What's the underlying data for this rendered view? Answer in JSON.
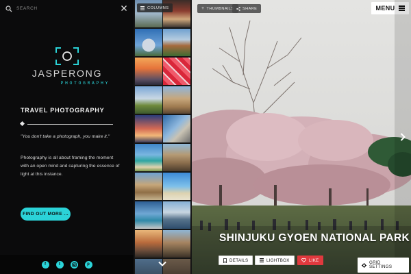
{
  "sidebar": {
    "search": {
      "placeholder": "SEARCH"
    },
    "logo": {
      "name": "JASPERONG",
      "sub": "PHOTOGRAPHY"
    },
    "section_title": "TRAVEL PHOTOGRAPHY",
    "quote": "\"You don't take a photograph, you make it.\"",
    "paragraph": "Photography is all about framing the moment with an open mind and capturing the essence of light at this instance.",
    "find_out_more": "FIND OUT MORE ...",
    "social": [
      "facebook-icon",
      "twitter-icon",
      "instagram-icon",
      "pinterest-icon"
    ]
  },
  "thumbstrip": {
    "columns_label": "COLUMNS"
  },
  "toolbar": {
    "thumbnails_label": "THUMBNAILS",
    "share_label": "SHARE",
    "menu_label": "MENU"
  },
  "photo": {
    "title": "SHINJUKU GYOEN NATIONAL PARK",
    "details_label": "DETAILS",
    "lightbox_label": "LIGHTBOX",
    "like_label": "LIKE",
    "grid_settings_label": "GRID SETTINGS"
  },
  "colors": {
    "accent": "#2bd3d8",
    "like": "#e0393e",
    "sidebar_bg": "#0b0b0c"
  }
}
